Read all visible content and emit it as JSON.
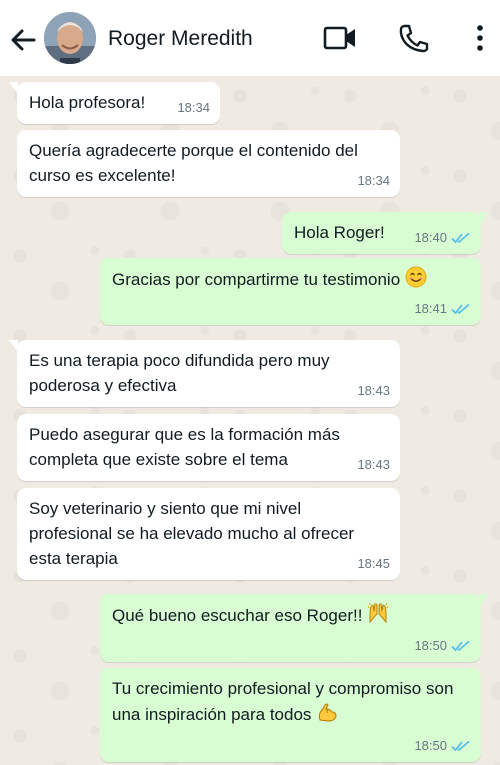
{
  "header": {
    "contact_name": "Roger Meredith",
    "back_icon": "arrow-left-icon",
    "video_icon": "video-camera-icon",
    "call_icon": "phone-icon",
    "menu_icon": "more-vertical-icon"
  },
  "messages": [
    {
      "dir": "in",
      "text": "Hola profesora!",
      "time": "18:34"
    },
    {
      "dir": "in",
      "text": "Quería agradecerte porque el contenido del curso es excelente!",
      "time": "18:34"
    },
    {
      "dir": "out",
      "text": "Hola Roger!",
      "time": "18:40",
      "status": "read"
    },
    {
      "dir": "out",
      "text": "Gracias por compartirme tu testimonio",
      "time": "18:41",
      "status": "read",
      "emoji": "smiling-face-icon"
    },
    {
      "dir": "in",
      "text": "Es una terapia poco difundida pero muy poderosa y efectiva",
      "time": "18:43"
    },
    {
      "dir": "in",
      "text": "Puedo asegurar que es la formación más completa que existe sobre el tema",
      "time": "18:43"
    },
    {
      "dir": "in",
      "text": "Soy veterinario y siento que mi nivel profesional se ha elevado mucho al ofrecer esta terapia",
      "time": "18:45"
    },
    {
      "dir": "out",
      "text": "Qué bueno escuchar eso Roger!!",
      "time": "18:50",
      "status": "read",
      "emoji": "raised-hands-icon"
    },
    {
      "dir": "out",
      "text": "Tu crecimiento profesional y compromiso son una inspiración para todos",
      "time": "18:50",
      "status": "read",
      "emoji": "flexed-biceps-icon"
    }
  ],
  "colors": {
    "incoming_bubble": "#ffffff",
    "outgoing_bubble": "#d9fdd3",
    "read_ticks": "#53bdeb",
    "wallpaper": "#efeae2"
  }
}
